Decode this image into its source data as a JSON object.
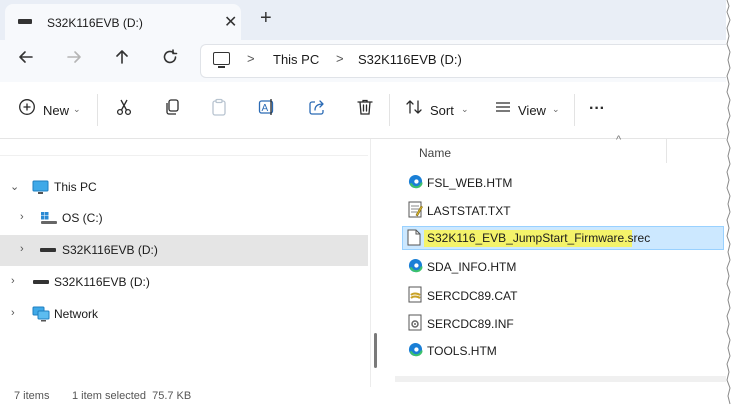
{
  "window": {
    "tab_title": "S32K116EVB (D:)",
    "tab_close": "✕",
    "new_tab": "+"
  },
  "address_bar": {
    "crumbs": [
      "This PC",
      "S32K116EVB (D:)"
    ],
    "separator": ">"
  },
  "command_bar": {
    "new_label": "New",
    "sort_label": "Sort",
    "view_label": "View",
    "more_label": "···"
  },
  "nav_pane": {
    "items": [
      {
        "label": "This PC",
        "expanded": true
      },
      {
        "label": "OS (C:)"
      },
      {
        "label": "S32K116EVB (D:)",
        "selected": true
      },
      {
        "label": "S32K116EVB (D:)"
      },
      {
        "label": "Network"
      }
    ]
  },
  "file_list": {
    "column_name": "Name",
    "files": [
      {
        "name": "FSL_WEB.HTM",
        "icon": "edge-icon"
      },
      {
        "name": "LASTSTAT.TXT",
        "icon": "text-file-icon"
      },
      {
        "name": "S32K116_EVB_JumpStart_Firmware.srec",
        "icon": "blank-file-icon",
        "selected": true
      },
      {
        "name": "SDA_INFO.HTM",
        "icon": "edge-icon"
      },
      {
        "name": "SERCDC89.CAT",
        "icon": "catalog-file-icon"
      },
      {
        "name": "SERCDC89.INF",
        "icon": "inf-file-icon"
      },
      {
        "name": "TOOLS.HTM",
        "icon": "edge-icon"
      }
    ]
  },
  "status_bar": {
    "item_count": "7 items",
    "selection": "1 item selected  75.7 KB"
  },
  "colors": {
    "selection_bg": "#cce8ff",
    "highlight": "#f4f36a",
    "edge_blue": "#1a7fd6",
    "edge_green": "#3cc36b"
  }
}
